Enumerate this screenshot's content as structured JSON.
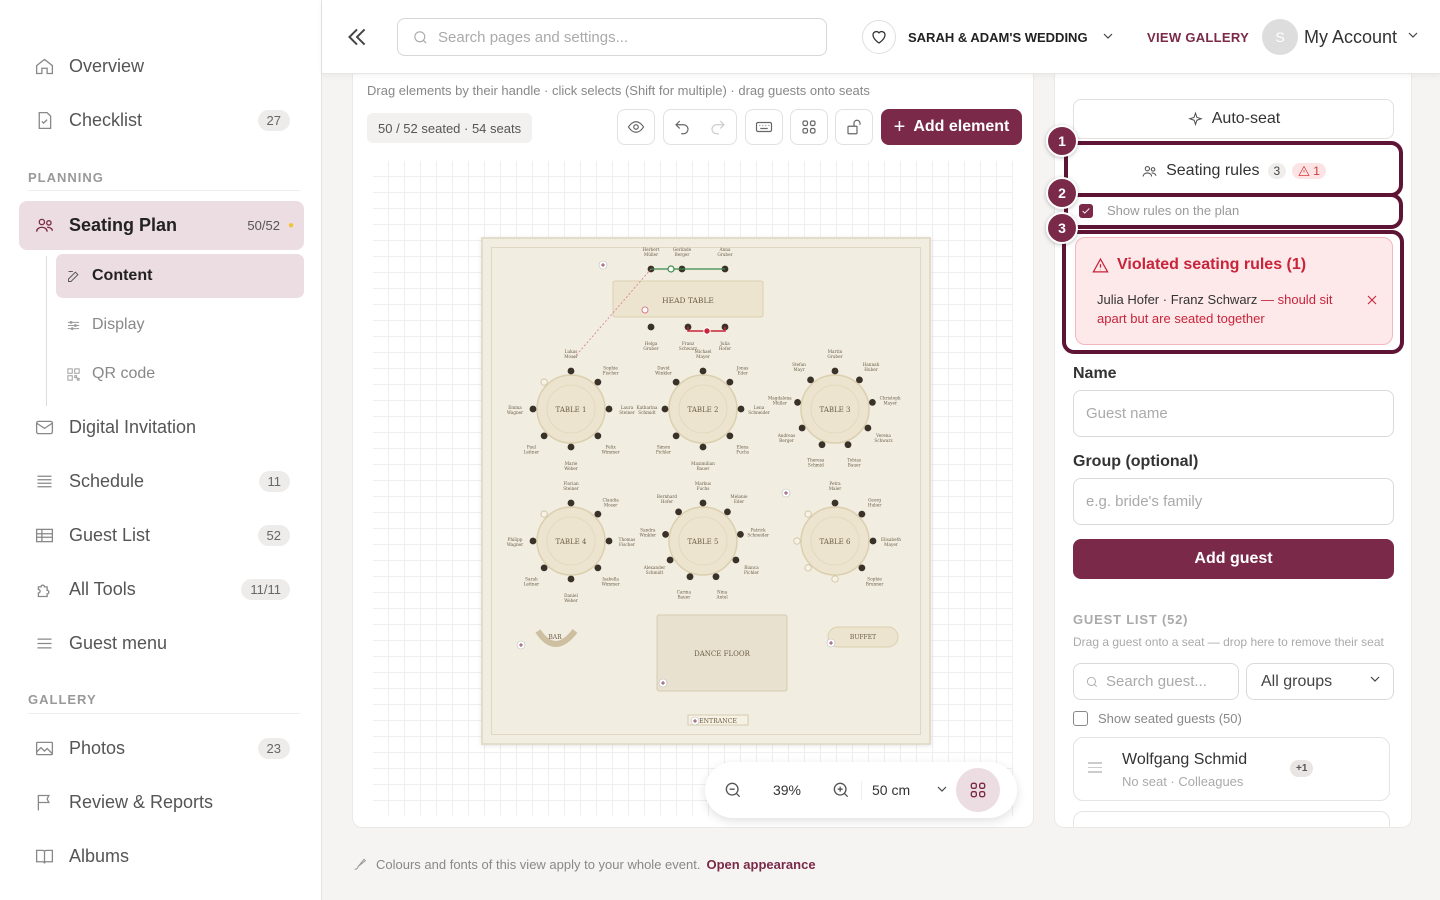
{
  "sidebar": {
    "items_top": [
      {
        "label": "Overview",
        "icon": "home-icon"
      },
      {
        "label": "Checklist",
        "icon": "file-check-icon",
        "badge": "27"
      }
    ],
    "planning_label": "PLANNING",
    "seating": {
      "label": "Seating Plan",
      "badge": "50/52",
      "icon": "people-icon"
    },
    "sub_items": [
      {
        "label": "Content",
        "icon": "edit-icon"
      },
      {
        "label": "Display",
        "icon": "sliders-icon"
      },
      {
        "label": "QR code",
        "icon": "qr-icon"
      }
    ],
    "items_mid": [
      {
        "label": "Digital Invitation",
        "icon": "mail-icon"
      },
      {
        "label": "Schedule",
        "icon": "list-icon",
        "badge": "11"
      },
      {
        "label": "Guest List",
        "icon": "table-icon",
        "badge": "52"
      },
      {
        "label": "All Tools",
        "icon": "puzzle-icon",
        "badge": "11/11"
      },
      {
        "label": "Guest menu",
        "icon": "menu-icon"
      }
    ],
    "gallery_label": "GALLERY",
    "items_gallery": [
      {
        "label": "Photos",
        "icon": "image-icon",
        "badge": "23"
      },
      {
        "label": "Review & Reports",
        "icon": "flag-icon"
      },
      {
        "label": "Albums",
        "icon": "book-icon"
      }
    ]
  },
  "topbar": {
    "search_placeholder": "Search pages and settings...",
    "event_name": "SARAH & ADAM'S WEDDING",
    "view_gallery": "VIEW GALLERY",
    "avatar_initial": "S",
    "account": "My Account"
  },
  "canvas": {
    "hint": "Drag elements by their handle · click selects (Shift for multiple) · drag guests onto seats",
    "stats": "50 / 52 seated · 54 seats",
    "add_element": "Add element",
    "zoom": "39%",
    "unit": "50 cm",
    "accent": "#7a2a48"
  },
  "plan": {
    "head_table": "HEAD TABLE",
    "head_guests_top": [
      "Herbert Müller",
      "Gerlinde Berger",
      "Anna Gruber"
    ],
    "head_guests_bottom": [
      "Helga Gruber",
      "Franz Schwarz",
      "Julia Hofer"
    ],
    "tables": [
      {
        "label": "TABLE 1",
        "guests": [
          "Lukas Moser",
          "Sophie Fischer",
          "Laura Steiner",
          "Felix Wimmer",
          "Marie Weber",
          "Paul Leitner",
          "Emma Wagner"
        ]
      },
      {
        "label": "TABLE 2",
        "guests": [
          "Michael Mayer",
          "Jonas Eder",
          "Lena Schneider",
          "Elena Fuchs",
          "Maximilian Bauer",
          "Simon Pichler",
          "Katharina Schmidt",
          "David Winkler"
        ]
      },
      {
        "label": "TABLE 3",
        "guests": [
          "Martin Gruber",
          "Hannah Huber",
          "Christoph Mayer",
          "Verena Schwarz",
          "Tobias Bauer",
          "Theresa Schmid",
          "Andreas Berger",
          "Magdalena Müller",
          "Stefan Mayr"
        ]
      },
      {
        "label": "TABLE 4",
        "guests": [
          "Florian Steiner",
          "Claudia Moser",
          "Thomas Fischer",
          "Isabella Wimmer",
          "Daniel Weber",
          "Sarah Leitner",
          "Philipp Wagner"
        ]
      },
      {
        "label": "TABLE 5",
        "guests": [
          "Markus Fuchs",
          "Melanie Eder",
          "Patrick Schneider",
          "Bianca Pichler",
          "Nina Antel",
          "Carina Bauer",
          "Alexander Schmidt",
          "Sandra Winkler",
          "Bernhard Hofer"
        ]
      },
      {
        "label": "TABLE 6",
        "guests": [
          "Petra Maier",
          "Georg Huber",
          "Elisabeth Mayer",
          "Sophie Brunner"
        ]
      }
    ],
    "bar": "BAR",
    "buffet": "BUFFET",
    "dance_floor": "DANCE FLOOR",
    "entrance": "ENTRANCE"
  },
  "rpanel": {
    "auto_seat": "Auto-seat",
    "seating_rules": "Seating rules",
    "rules_count": "3",
    "rules_warn": "1",
    "show_rules": "Show rules on the plan",
    "violation_title": "Violated seating rules (1)",
    "violation_names": "Julia Hofer · Franz Schwarz",
    "violation_desc": " — should sit apart but are seated together",
    "name_label": "Name",
    "name_placeholder": "Guest name",
    "group_label": "Group (optional)",
    "group_placeholder": "e.g. bride's family",
    "add_guest": "Add guest",
    "guest_list_head": "GUEST LIST (52)",
    "guest_list_hint": "Drag a guest onto a seat — drop here to remove their seat",
    "guest_search_placeholder": "Search guest...",
    "group_filter": "All groups",
    "show_seated": "Show seated guests (50)",
    "guest_name": "Wolfgang Schmid",
    "guest_sub": "No seat · Colleagues",
    "guest_plus": "+1"
  },
  "footer": {
    "note": "Colours and fonts of this view apply to your whole event.",
    "link": "Open appearance"
  },
  "steps": [
    "1",
    "2",
    "3"
  ]
}
